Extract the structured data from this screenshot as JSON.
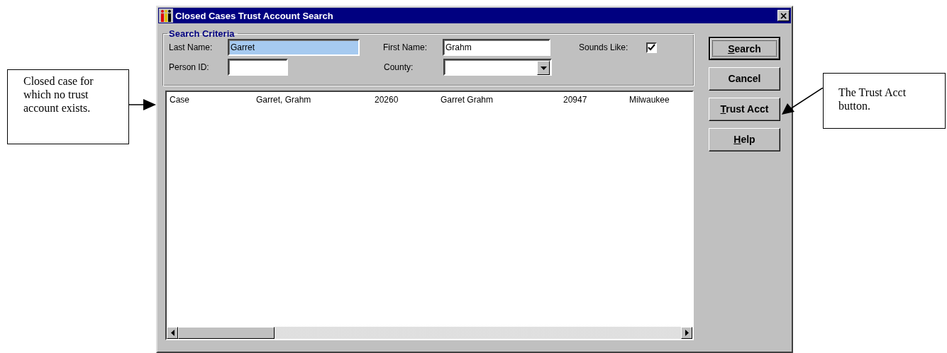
{
  "callouts": [
    {
      "text": "Closed case for which no trust account exists."
    },
    {
      "text": "The Trust Acct button."
    }
  ],
  "window": {
    "title": "Closed Cases Trust Account Search",
    "close": "×"
  },
  "search_criteria": {
    "legend": "Search Criteria",
    "last_name": {
      "label": "Last Name:",
      "value": "Garret",
      "highlighted": true
    },
    "first_name": {
      "label": "First Name:",
      "value": "Grahm",
      "highlighted": false
    },
    "sounds_like": {
      "label": "Sounds Like:",
      "checked": true
    },
    "person_id": {
      "label": "Person ID:"
    },
    "county": {
      "label": "County:"
    }
  },
  "results": {
    "rows": [
      {
        "cells": [
          "Case",
          "Garret, Grahm",
          "20260",
          "Garret Grahm",
          "20947",
          "Milwaukee"
        ]
      }
    ]
  },
  "buttons": [
    {
      "key": "S",
      "rest": "earch",
      "default": true
    },
    {
      "rest": "Cancel",
      "default": false
    },
    {
      "key": "T",
      "rest": "rust Acct",
      "default": false
    },
    {
      "key": "H",
      "rest": "elp",
      "default": false
    }
  ]
}
